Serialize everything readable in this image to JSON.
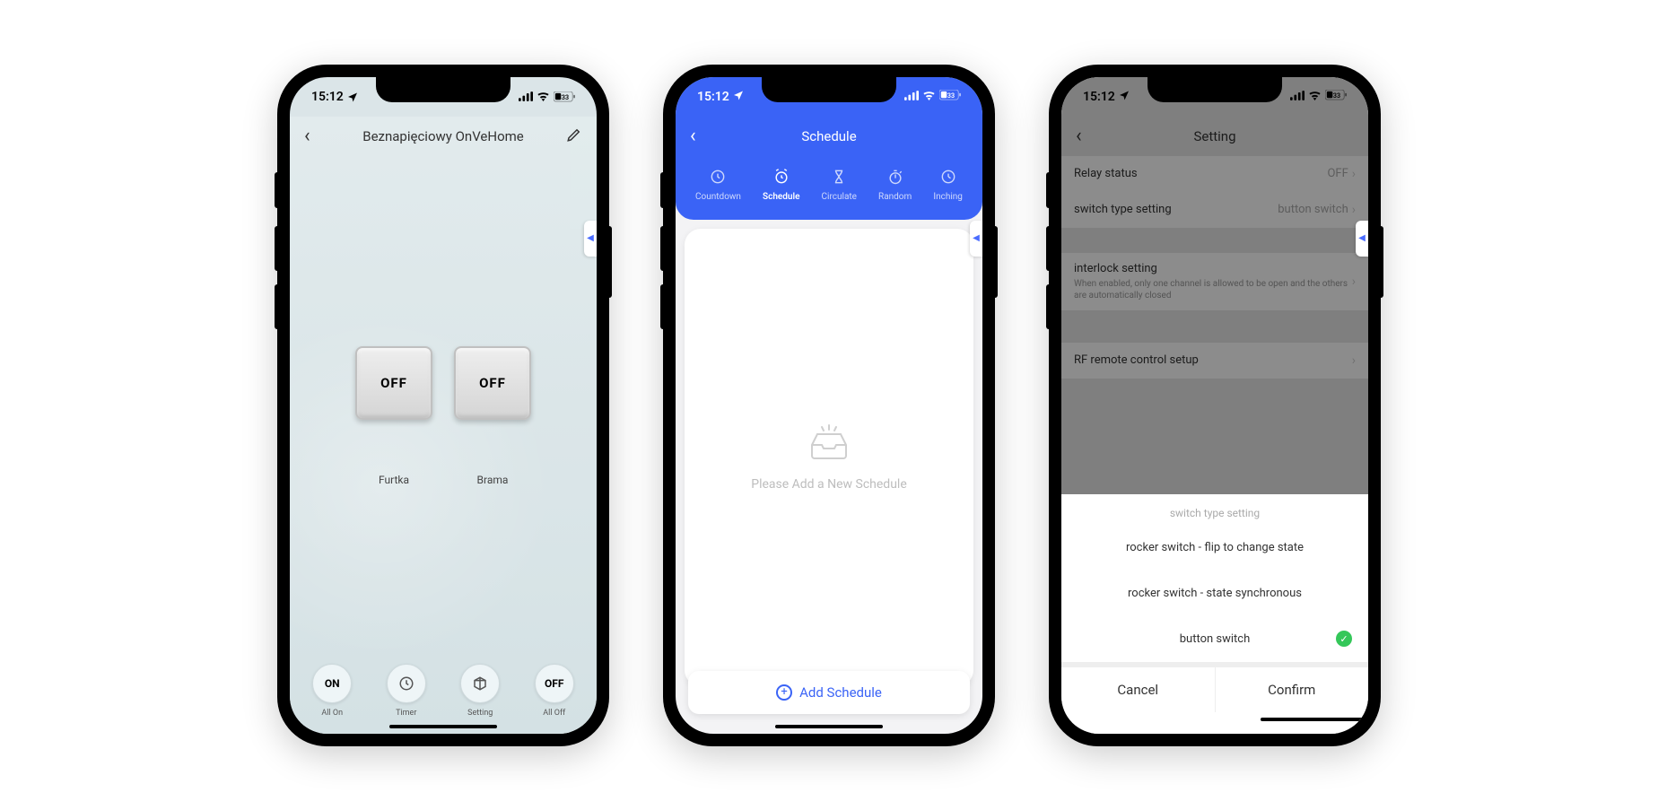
{
  "status": {
    "time": "15:12",
    "battery_text": "33"
  },
  "screen1": {
    "title": "Beznapięciowy OnVeHome",
    "switch1": {
      "state": "OFF",
      "label": "Furtka"
    },
    "switch2": {
      "state": "OFF",
      "label": "Brama"
    },
    "toolbar": {
      "all_on": {
        "glyph": "ON",
        "label": "All On"
      },
      "timer": {
        "label": "Timer"
      },
      "setting": {
        "label": "Setting"
      },
      "all_off": {
        "glyph": "OFF",
        "label": "All Off"
      }
    }
  },
  "screen2": {
    "title": "Schedule",
    "tabs": {
      "countdown": "Countdown",
      "schedule": "Schedule",
      "circulate": "Circulate",
      "random": "Random",
      "inching": "Inching"
    },
    "empty_text": "Please Add a New Schedule",
    "add_label": "Add Schedule"
  },
  "screen3": {
    "title": "Setting",
    "rows": {
      "relay": {
        "label": "Relay status",
        "value": "OFF"
      },
      "swtype": {
        "label": "switch type setting",
        "value": "button switch"
      },
      "interlock": {
        "label": "interlock setting",
        "sub": "When enabled, only one channel is allowed to be open and the others are automatically closed"
      },
      "rf": {
        "label": "RF remote control setup"
      }
    },
    "sheet": {
      "title": "switch type setting",
      "options": {
        "rocker_flip": "rocker switch - flip to change state",
        "rocker_sync": "rocker switch - state synchronous",
        "button": "button switch"
      },
      "cancel": "Cancel",
      "confirm": "Confirm"
    }
  }
}
